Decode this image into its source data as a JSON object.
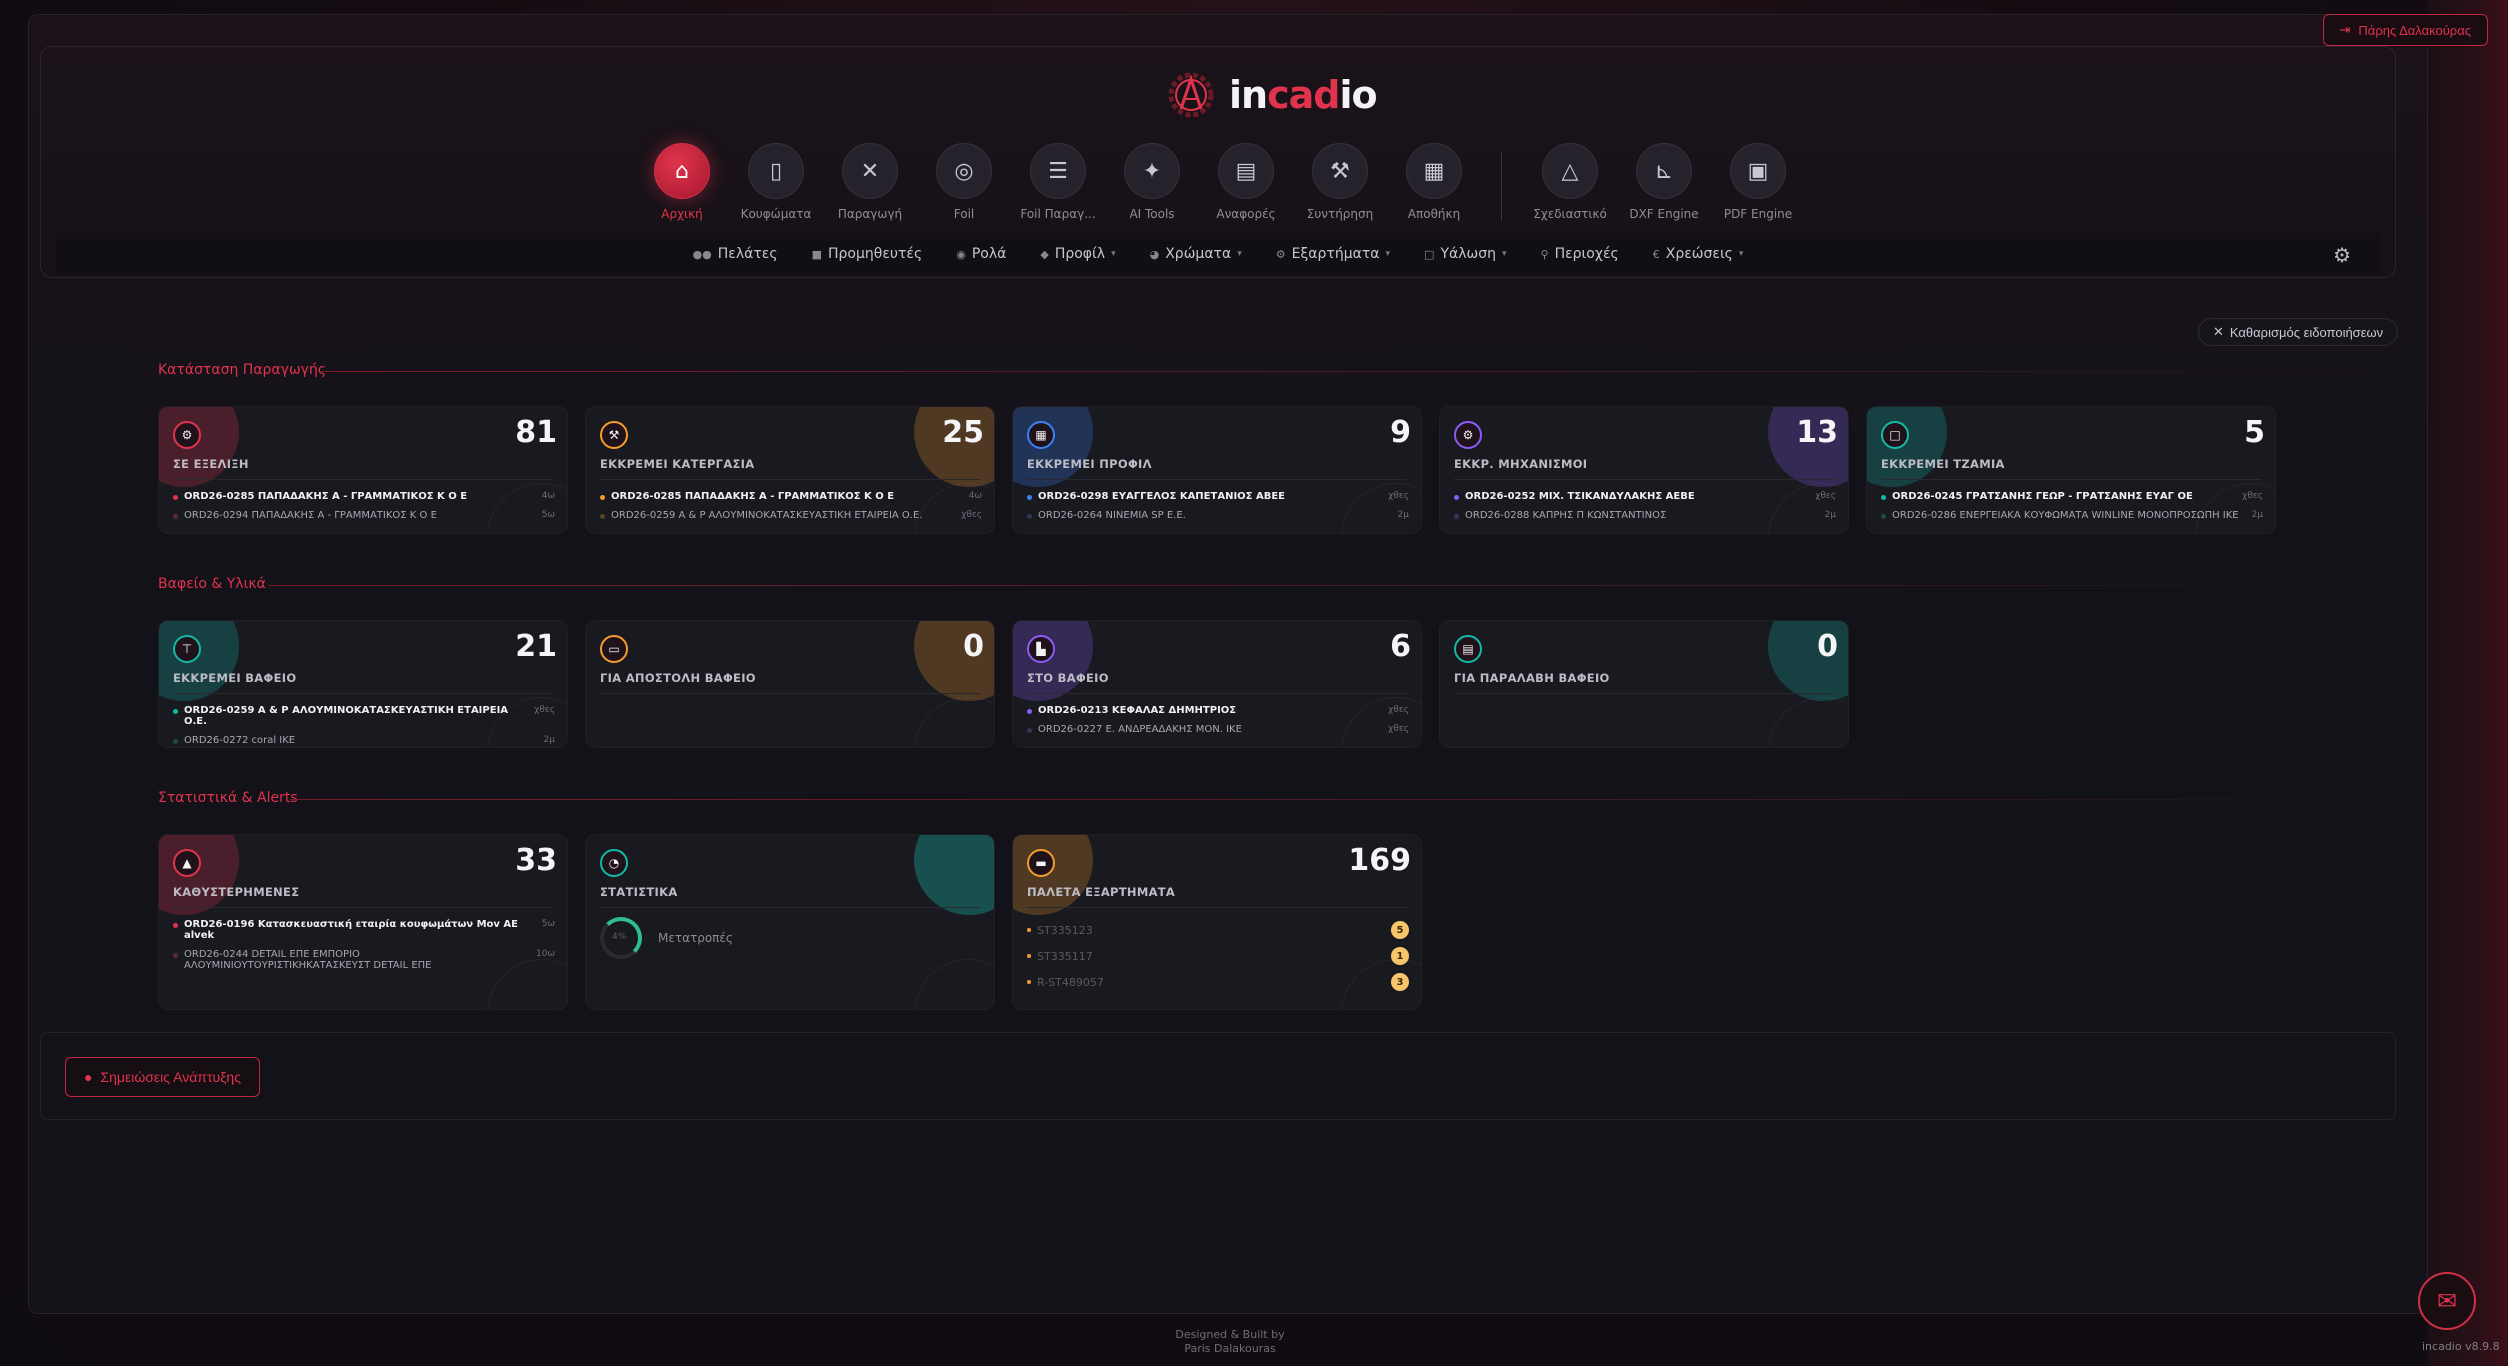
{
  "header": {
    "logout_label": "Πάρης Δαλακούρας",
    "logo": {
      "prefix": "in",
      "accent": "cad",
      "suffix": "io"
    },
    "nav": [
      {
        "key": "home",
        "label": "Αρχική",
        "icon": "home-icon",
        "active": true
      },
      {
        "key": "windows",
        "label": "Κουφώματα",
        "icon": "door-icon"
      },
      {
        "key": "production",
        "label": "Παραγωγή",
        "icon": "tools-icon"
      },
      {
        "key": "foil",
        "label": "Foil",
        "icon": "roll-icon"
      },
      {
        "key": "foil-prod",
        "label": "Foil Παραγ...",
        "icon": "checklist-icon"
      },
      {
        "key": "ai",
        "label": "AI Tools",
        "icon": "magic-wand-icon"
      },
      {
        "key": "reports",
        "label": "Αναφορές",
        "icon": "chart-icon"
      },
      {
        "key": "maintenance",
        "label": "Συντήρηση",
        "icon": "wrench-icon"
      },
      {
        "key": "warehouse",
        "label": "Αποθήκη",
        "icon": "warehouse-icon"
      },
      {
        "key": "drawing",
        "label": "Σχεδιαστικό",
        "icon": "compass-icon"
      },
      {
        "key": "dxf",
        "label": "DXF Engine",
        "icon": "ruler-icon"
      },
      {
        "key": "pdf",
        "label": "PDF Engine",
        "icon": "pdf-icon"
      }
    ],
    "subnav": [
      {
        "label": "Πελάτες",
        "icon": "users-icon",
        "caret": false
      },
      {
        "label": "Προμηθευτές",
        "icon": "truck-icon",
        "caret": false
      },
      {
        "label": "Ρολά",
        "icon": "roll-icon",
        "caret": false
      },
      {
        "label": "Προφίλ",
        "icon": "layers-icon",
        "caret": true
      },
      {
        "label": "Χρώματα",
        "icon": "palette-icon",
        "caret": true
      },
      {
        "label": "Εξαρτήματα",
        "icon": "gears-icon",
        "caret": true
      },
      {
        "label": "Υάλωση",
        "icon": "square-icon",
        "caret": true
      },
      {
        "label": "Περιοχές",
        "icon": "pin-icon",
        "caret": false
      },
      {
        "label": "Χρεώσεις",
        "icon": "euro-icon",
        "caret": true
      }
    ]
  },
  "clear_notifications": "Καθαρισμός ειδοποιήσεων",
  "sections": {
    "production": "Κατάσταση Παραγωγής",
    "paint": "Βαφείο & Υλικά",
    "stats": "Στατιστικά & Alerts"
  },
  "cards": {
    "in_progress": {
      "count": "81",
      "label": "ΣΕ ΕΞΕΛΙΞΗ",
      "color": "#e0334d",
      "icon": "gears-icon",
      "rows": [
        {
          "text": "ORD26-0285 ΠΑΠΑΔΑΚΗΣ Α - ΓΡΑΜΜΑΤΙΚΟΣ Κ Ο Ε",
          "ago": "4ω"
        },
        {
          "text": "ORD26-0294 ΠΑΠΑΔΑΚΗΣ Α - ΓΡΑΜΜΑΤΙΚΟΣ Κ Ο Ε",
          "ago": "5ω"
        }
      ]
    },
    "pending_processing": {
      "count": "25",
      "label": "ΕΚΚΡΕΜΕΙ ΚΑΤΕΡΓΑΣΙΑ",
      "color": "#f39c2a",
      "icon": "hammer-icon",
      "rows": [
        {
          "text": "ORD26-0285 ΠΑΠΑΔΑΚΗΣ Α - ΓΡΑΜΜΑΤΙΚΟΣ Κ Ο Ε",
          "ago": "4ω"
        },
        {
          "text": "ORD26-0259 Α & Ρ ΑΛΟΥΜΙΝΟΚΑΤΑΣΚΕΥΑΣΤΙΚΗ ΕΤΑΙΡΕΙΑ Ο.Ε.",
          "ago": "χθες"
        }
      ]
    },
    "pending_profile": {
      "count": "9",
      "label": "ΕΚΚΡΕΜΕΙ ΠΡΟΦΙΛ",
      "color": "#3b82f6",
      "icon": "grid-icon",
      "rows": [
        {
          "text": "ORD26-0298 ΕΥΑΓΓΕΛΟΣ ΚΑΠΕΤΑΝΙΟΣ ΑΒΕΕ",
          "ago": "χθες"
        },
        {
          "text": "ORD26-0264 NINEMIA SP E.E.",
          "ago": "2μ"
        }
      ]
    },
    "pending_mechanisms": {
      "count": "13",
      "label": "ΕΚΚΡ. ΜΗΧΑΝΙΣΜΟΙ",
      "color": "#8b5cf6",
      "icon": "gears-icon",
      "rows": [
        {
          "text": "ORD26-0252 ΜΙΧ. ΤΣΙΚΑΝΔΥΛΑΚΗΣ ΑΕΒΕ",
          "ago": "χθες"
        },
        {
          "text": "ORD26-0288 ΚΑΠΡΗΣ Π ΚΩΝΣΤΑΝΤΙΝΟΣ",
          "ago": "2μ"
        }
      ]
    },
    "pending_glass": {
      "count": "5",
      "label": "ΕΚΚΡΕΜΕΙ ΤΖΑΜΙΑ",
      "color": "#14b8a6",
      "icon": "square-icon",
      "rows": [
        {
          "text": "ORD26-0245 ΓΡΑΤΣΑΝΗΣ ΓΕΩΡ - ΓΡΑΤΣΑΝΗΣ ΕΥΑΓ ΟΕ",
          "ago": "χθες"
        },
        {
          "text": "ORD26-0286 ΕΝΕΡΓΕΙΑΚΑ ΚΟΥΦΩΜΑΤΑ WINLINE ΜΟΝΟΠΡΟΣΩΠΗ ΙΚΕ",
          "ago": "2μ"
        }
      ]
    },
    "pending_paint": {
      "count": "21",
      "label": "ΕΚΚΡΕΜΕΙ ΒΑΦΕΙΟ",
      "color": "#14b8a6",
      "icon": "paint-roller-icon",
      "rows": [
        {
          "text": "ORD26-0259 Α & Ρ ΑΛΟΥΜΙΝΟΚΑΤΑΣΚΕΥΑΣΤΙΚΗ ΕΤΑΙΡΕΙΑ Ο.Ε.",
          "ago": "χθες"
        },
        {
          "text": "ORD26-0272 coral IKE",
          "ago": "2μ"
        }
      ]
    },
    "send_paint": {
      "count": "0",
      "label": "ΓΙΑ ΑΠΟΣΤΟΛΗ ΒΑΦΕΙΟ",
      "color": "#f39c2a",
      "icon": "document-icon",
      "rows": []
    },
    "at_paint": {
      "count": "6",
      "label": "ΣΤΟ ΒΑΦΕΙΟ",
      "color": "#8b5cf6",
      "icon": "factory-icon",
      "rows": [
        {
          "text": "ORD26-0213 ΚΕΦΑΛΑΣ ΔΗΜΗΤΡΙΟΣ",
          "ago": "χθες"
        },
        {
          "text": "ORD26-0227 Ε. ΑΝΔΡΕΑΔΑΚΗΣ ΜΟΝ. ΙΚΕ",
          "ago": "χθες"
        }
      ]
    },
    "receive_paint": {
      "count": "0",
      "label": "ΓΙΑ ΠΑΡΑΛΑΒΗ ΒΑΦΕΙΟ",
      "color": "#14b8a6",
      "icon": "clipboard-icon",
      "rows": []
    },
    "delayed": {
      "count": "33",
      "label": "ΚΑΘΥΣΤΕΡΗΜΕΝΕΣ",
      "color": "#e0334d",
      "icon": "warning-icon",
      "rows": [
        {
          "text": "ORD26-0196 Κατασκευαστική εταιρία κουφωμάτων Mov AE alvek",
          "ago": "5ω"
        },
        {
          "text": "ORD26-0244 DETAIL ΕΠΕ ΕΜΠΟΡΙΟ ΑΛΟΥΜΙΝΙΟΥΤΟΥΡΙΣΤΙΚΗΚΑΤΑΣΚΕΥΣΤ DETAIL ΕΠΕ",
          "ago": "10ω"
        }
      ]
    },
    "statistics": {
      "label": "ΣΤΑΤΙΣΤΙΚΑ",
      "color": "#14b8a6",
      "icon": "pie-chart-icon",
      "stat_label": "Μετατροπές",
      "stat_value": "4%"
    },
    "palette": {
      "count": "169",
      "label": "ΠΑΛΕΤΑ ΕΞΑΡΤΗΜΑΤΑ",
      "color": "#f39c2a",
      "icon": "pallet-icon",
      "rows": [
        {
          "text": "ST335123",
          "badge": "5"
        },
        {
          "text": "ST335117",
          "badge": "1"
        },
        {
          "text": "R-ST489057",
          "badge": "3"
        }
      ]
    }
  },
  "notes_button": "Σημειώσεις Ανάπτυξης",
  "footer": {
    "line1": "Designed & Built by",
    "line2": "Paris Dalakouras"
  },
  "version": "incadio v8.9.8"
}
